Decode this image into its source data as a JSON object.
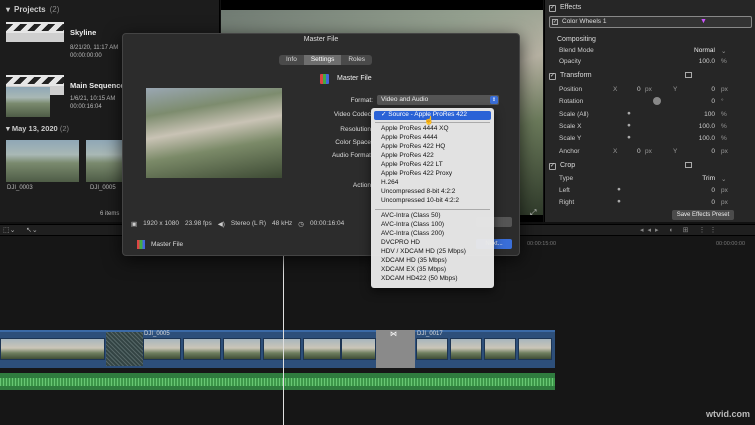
{
  "library": {
    "header": "Projects",
    "count": "(2)",
    "projects": [
      {
        "title": "Skyline",
        "date": "8/21/20, 11:17 AM",
        "duration": "00:00:00:00"
      },
      {
        "title": "Main Sequence",
        "date": "1/6/21, 10:15 AM",
        "duration": "00:00:16:04"
      }
    ],
    "date_group": "May 13, 2020",
    "date_count": "(2)",
    "clips": [
      "DJI_0003",
      "DJI_0005"
    ],
    "items_count": "6 items"
  },
  "inspector": {
    "effects_label": "Effects",
    "color_wheels_label": "Color Wheels 1",
    "compositing_label": "Compositing",
    "blend_mode_label": "Blend Mode",
    "blend_mode_value": "Normal",
    "opacity_label": "Opacity",
    "opacity_value": "100.0",
    "opacity_unit": "%",
    "transform_label": "Transform",
    "position_label": "Position",
    "position_x": "0",
    "position_y": "0",
    "rotation_label": "Rotation",
    "rotation_value": "0",
    "scale_all_label": "Scale (All)",
    "scale_all_value": "100",
    "scale_x_label": "Scale X",
    "scale_x_value": "100.0",
    "scale_y_label": "Scale Y",
    "scale_y_value": "100.0",
    "anchor_label": "Anchor",
    "anchor_x": "0",
    "anchor_y": "0",
    "crop_label": "Crop",
    "type_label": "Type",
    "type_value": "Trim",
    "left_label": "Left",
    "left_value": "0",
    "right_label": "Right",
    "right_value": "0",
    "unit_px": "px",
    "unit_percent": "%",
    "unit_deg": "°",
    "axis_x": "X",
    "axis_y": "Y",
    "save_preset": "Save Effects Preset"
  },
  "dialog": {
    "title": "Master File",
    "tabs": [
      "Info",
      "Settings",
      "Roles"
    ],
    "file_title": "Master File",
    "format_label": "Format:",
    "format_value": "Video and Audio",
    "video_codec_label": "Video Codec",
    "resolution_label": "Resolution",
    "color_space_label": "Color Space",
    "audio_format_label": "Audio Format",
    "action_label": "Action",
    "info_resolution": "1920 x 1080",
    "info_fps": "23.98 fps",
    "info_audio": "Stereo (L R)",
    "info_khz": "48 kHz",
    "info_duration": "00:00:16:04",
    "footer_name": "Master File",
    "next_label": "Next..."
  },
  "dropdown": {
    "selected": "Source - Apple ProRes 422",
    "group1": [
      "Apple ProRes 4444 XQ",
      "Apple ProRes 4444",
      "Apple ProRes 422 HQ",
      "Apple ProRes 422",
      "Apple ProRes 422 LT",
      "Apple ProRes 422 Proxy",
      "H.264",
      "Uncompressed 8-bit 4:2:2",
      "Uncompressed 10-bit 4:2:2"
    ],
    "group2": [
      "AVC-Intra (Class 50)",
      "AVC-Intra (Class 100)",
      "AVC-Intra (Class 200)",
      "DVCPRO HD",
      "HDV / XDCAM HD (25 Mbps)",
      "XDCAM HD (35 Mbps)",
      "XDCAM EX (35 Mbps)",
      "XDCAM HD422 (50 Mbps)"
    ]
  },
  "timeline": {
    "ruler": [
      "00:00:15:00",
      "00:00:00:00"
    ],
    "clip_a": "DJI_0005",
    "clip_b": "DJI_0017"
  },
  "watermark": "wtvid.com"
}
